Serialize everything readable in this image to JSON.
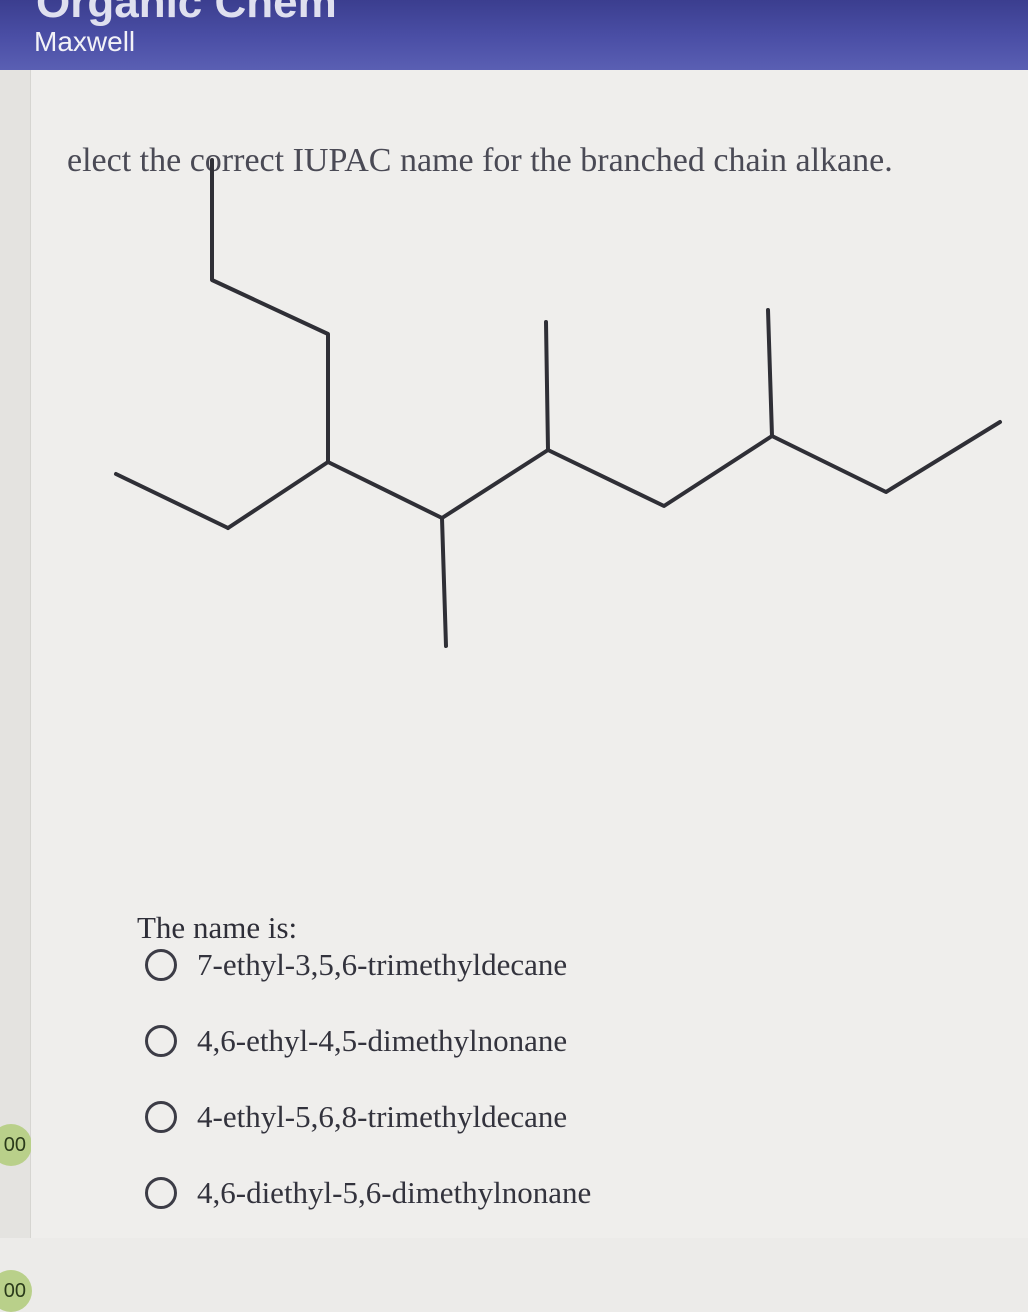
{
  "header": {
    "app_title": "Organic Chem",
    "user_name": "Maxwell"
  },
  "sidebar": {
    "scores": [
      "00",
      "00"
    ]
  },
  "question": {
    "prompt": "elect the correct IUPAC name for the branched chain alkane.",
    "answer_heading": "The name is:",
    "options": [
      {
        "label": "7-ethyl-3,5,6-trimethyldecane",
        "selected": false
      },
      {
        "label": "4,6-ethyl-4,5-dimethylnonane",
        "selected": false
      },
      {
        "label": "4-ethyl-5,6,8-trimethyldecane",
        "selected": false
      },
      {
        "label": "4,6-diethyl-5,6-dimethylnonane",
        "selected": false
      }
    ]
  },
  "colors": {
    "header_band": "#4b4fa6",
    "page_background": "#efeeec",
    "bond_color": "#2f2f36",
    "score_badge": "#b9d08a"
  }
}
